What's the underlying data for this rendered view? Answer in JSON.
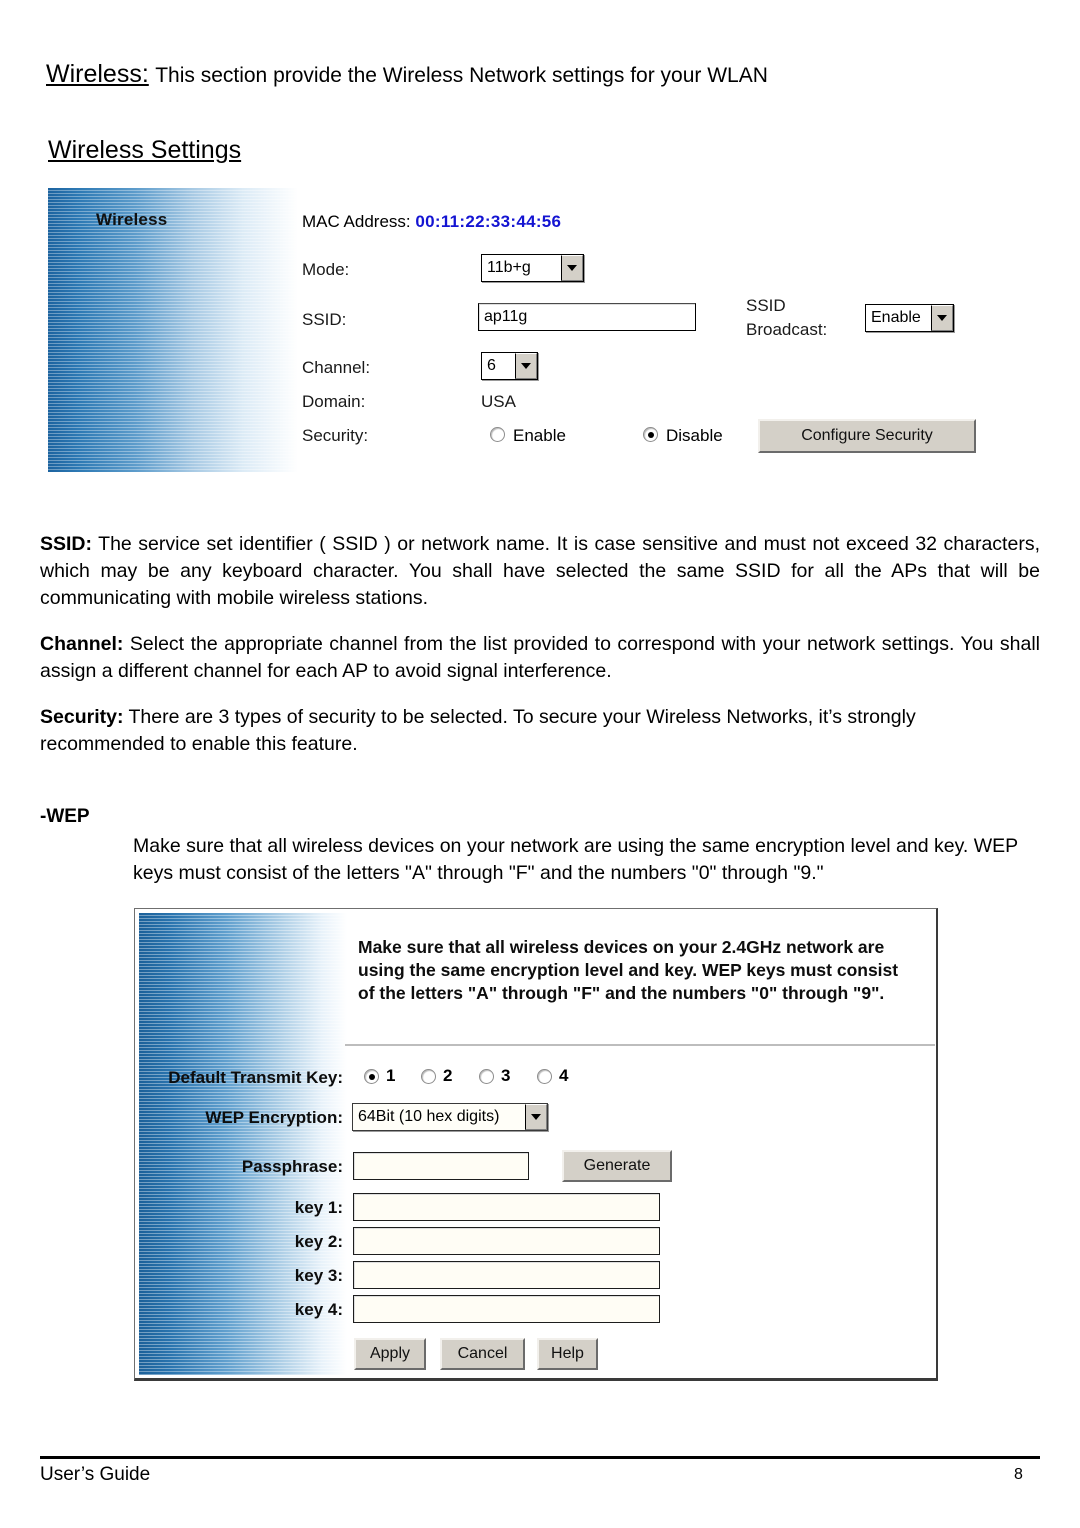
{
  "document": {
    "heading_keyword": "Wireless:",
    "heading_rest": "This section provide the Wireless Network settings for your WLAN",
    "section_title": "Wireless Settings"
  },
  "wireless_panel": {
    "panel_title": "Wireless",
    "mac_label": "MAC Address:",
    "mac_value": "00:11:22:33:44:56",
    "mac_color": "#1414d2",
    "mode_label": "Mode:",
    "mode_value": "11b+g",
    "ssid_label": "SSID:",
    "ssid_value": "ap11g",
    "ssid_broadcast_label_line1": "SSID",
    "ssid_broadcast_label_line2": "Broadcast:",
    "ssid_broadcast_value": "Enable",
    "channel_label": "Channel:",
    "channel_value": "6",
    "domain_label": "Domain:",
    "domain_value": "USA",
    "security_label": "Security:",
    "security_enable_label": "Enable",
    "security_disable_label": "Disable",
    "security_selected": "Disable",
    "configure_security_button": "Configure Security"
  },
  "body": {
    "ssid_paragraph_bold": "SSID:",
    "ssid_paragraph": " The service set identifier ( SSID ) or network name. It is case sensitive and must not exceed 32 characters, which may be any keyboard character. You shall have selected the same SSID for all the APs that will be communicating with mobile wireless stations.",
    "channel_paragraph_bold": "Channel:",
    "channel_paragraph": " Select the appropriate channel from the list provided to correspond with your network settings. You shall assign a different channel for each AP to avoid signal interference.",
    "security_paragraph_bold": "Security:",
    "security_paragraph": " There are 3 types of security to be selected. To secure your Wireless Networks, it’s strongly recommended to enable this feature.",
    "wep_heading": "-WEP",
    "wep_paragraph": "Make sure that all wireless devices on your network are using the same encryption level and key. WEP keys must consist of the letters \"A\" through \"F\" and the numbers \"0\" through \"9.\""
  },
  "wep_panel": {
    "note": "Make sure that all wireless devices on your 2.4GHz network are using the same encryption level and key. WEP keys must consist of the letters \"A\" through \"F\" and the numbers \"0\" through \"9\".",
    "default_transmit_key_label": "Default Transmit Key:",
    "transmit_keys": [
      "1",
      "2",
      "3",
      "4"
    ],
    "transmit_key_selected": "1",
    "wep_encryption_label": "WEP Encryption:",
    "wep_encryption_value": "64Bit (10 hex digits)",
    "passphrase_label": "Passphrase:",
    "passphrase_value": "",
    "generate_button": "Generate",
    "key1_label": "key 1:",
    "key1_value": "",
    "key2_label": "key 2:",
    "key2_value": "",
    "key3_label": "key 3:",
    "key3_value": "",
    "key4_label": "key 4:",
    "key4_value": "",
    "apply_button": "Apply",
    "cancel_button": "Cancel",
    "help_button": "Help"
  },
  "footer": {
    "left": "User’s Guide",
    "page_number": "8"
  }
}
